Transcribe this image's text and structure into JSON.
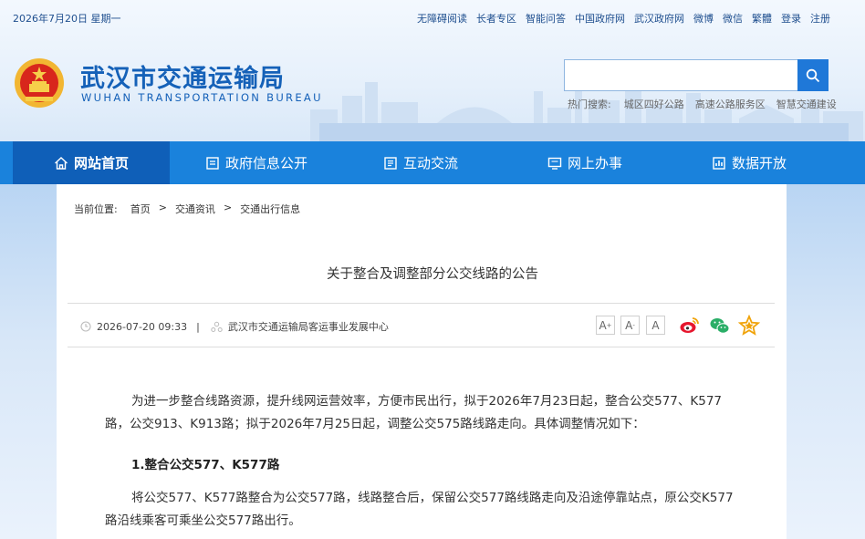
{
  "topbar": {
    "date": "2026年7月20日 星期一",
    "links": [
      "无障碍阅读",
      "长者专区",
      "智能问答",
      "中国政府网",
      "武汉政府网",
      "微博",
      "微信",
      "繁體",
      "登录",
      "注册"
    ]
  },
  "brand": {
    "title": "武汉市交通运输局",
    "subtitle": "WUHAN TRANSPORTATION BUREAU"
  },
  "search": {
    "value": "",
    "hot_label": "热门搜索:",
    "hot_terms": [
      "城区四好公路",
      "高速公路服务区",
      "智慧交通建设"
    ]
  },
  "nav": {
    "items": [
      {
        "label": "网站首页",
        "icon": "home-icon"
      },
      {
        "label": "政府信息公开",
        "icon": "document-icon"
      },
      {
        "label": "互动交流",
        "icon": "chat-icon"
      },
      {
        "label": "网上办事",
        "icon": "monitor-icon"
      },
      {
        "label": "数据开放",
        "icon": "data-icon"
      }
    ]
  },
  "breadcrumb": [
    "当前位置:",
    "首页",
    ">",
    "交通资讯",
    ">",
    "交通出行信息"
  ],
  "article": {
    "title": "关于整合及调整部分公交线路的公告",
    "datetime": "2026-07-20 09:33",
    "separator": "|",
    "source": "武汉市交通运输局客运事业发展中心",
    "font_buttons": [
      "A",
      "A",
      "A"
    ],
    "paragraph1": "为进一步整合线路资源，提升线网运营效率，方便市民出行，拟于2026年7月23日起，整合公交577、K577路，公交913、K913路；拟于2026年7月25日起，调整公交575路线路走向。具体调整情况如下：",
    "subhead1": "1.整合公交577、K577路",
    "paragraph2": "将公交577、K577路整合为公交577路，线路整合后，保留公交577路线路走向及沿途停靠站点，原公交K577路沿线乘客可乘坐公交577路出行。"
  },
  "colors": {
    "brand_blue": "#1561b8",
    "nav_blue": "#1a82dc",
    "nav_active": "#0f5fb8",
    "weibo": "#e6162d",
    "wechat": "#2aae67",
    "favorite": "#f0a30a"
  }
}
